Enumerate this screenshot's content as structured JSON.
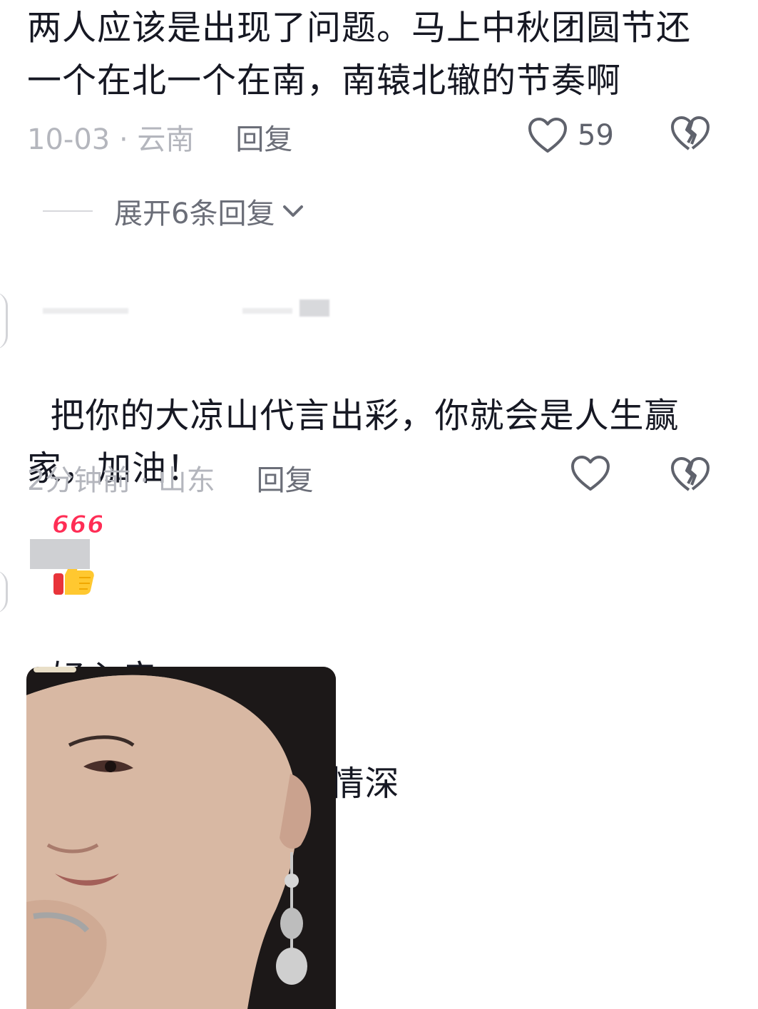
{
  "comments": [
    {
      "text": "两人应该是出现了问题。马上中秋团圆节还一个在北一个在南，南辕北辙的节奏啊",
      "time_location": "10-03 · 云南",
      "reply_label": "回复",
      "like_count": "59",
      "expand_label": "展开6条回复"
    },
    {
      "text": "把你的大凉山代言出彩，你就会是人生赢家，加油！",
      "emoji_666": "666",
      "time_location": "2分钟前 · 山东",
      "reply_label": "回复"
    },
    {
      "text_part1": "好心疼，",
      "text_part2": "，情不知所起一往情深"
    }
  ],
  "icons": {
    "like": "heart-outline-icon",
    "dislike": "broken-heart-icon",
    "expand": "chevron-down-icon"
  },
  "colors": {
    "primary_text": "#161823",
    "secondary_text": "#b4b6bd",
    "reply_text": "#6b6e78"
  }
}
